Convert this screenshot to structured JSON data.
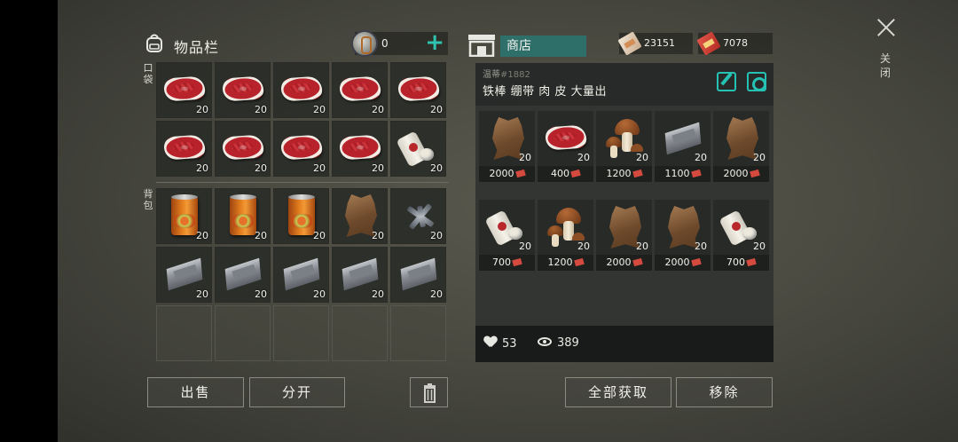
{
  "inventory": {
    "title": "物品栏",
    "coin_value": "0",
    "plus_label": "+",
    "pocket_label": "口袋",
    "backpack_label": "背包",
    "pocket_slots": [
      {
        "item": "meat",
        "qty": "20"
      },
      {
        "item": "meat",
        "qty": "20"
      },
      {
        "item": "meat",
        "qty": "20"
      },
      {
        "item": "meat",
        "qty": "20"
      },
      {
        "item": "meat",
        "qty": "20"
      },
      {
        "item": "meat",
        "qty": "20"
      },
      {
        "item": "meat",
        "qty": "20"
      },
      {
        "item": "meat",
        "qty": "20"
      },
      {
        "item": "meat",
        "qty": "20"
      },
      {
        "item": "bandage",
        "qty": "20"
      }
    ],
    "backpack_slots": [
      {
        "item": "food-can",
        "qty": "20"
      },
      {
        "item": "food-can",
        "qty": "20"
      },
      {
        "item": "food-can",
        "qty": "20"
      },
      {
        "item": "pelt",
        "qty": "20"
      },
      {
        "item": "scrap-metal",
        "qty": "20"
      },
      {
        "item": "iron-ingot",
        "qty": "20"
      },
      {
        "item": "iron-ingot",
        "qty": "20"
      },
      {
        "item": "iron-ingot",
        "qty": "20"
      },
      {
        "item": "iron-ingot",
        "qty": "20"
      },
      {
        "item": "iron-ingot",
        "qty": "20"
      },
      {
        "item": "",
        "qty": ""
      },
      {
        "item": "",
        "qty": ""
      },
      {
        "item": "",
        "qty": ""
      },
      {
        "item": "",
        "qty": ""
      },
      {
        "item": "",
        "qty": ""
      }
    ],
    "sell_label": "出售",
    "split_label": "分开"
  },
  "shop": {
    "tab_label": "商店",
    "currency_1": "23151",
    "currency_2": "7078",
    "owner_name": "温蒂",
    "owner_id": "#1882",
    "description": "铁棒 绷带 肉 皮 大量出",
    "items": [
      {
        "item": "pelt",
        "qty": "20",
        "price": "2000"
      },
      {
        "item": "meat",
        "qty": "20",
        "price": "400"
      },
      {
        "item": "mushroom",
        "qty": "20",
        "price": "1200"
      },
      {
        "item": "iron-ingot",
        "qty": "20",
        "price": "1100"
      },
      {
        "item": "pelt",
        "qty": "20",
        "price": "2000"
      },
      {
        "item": "bandage",
        "qty": "20",
        "price": "700"
      },
      {
        "item": "mushroom",
        "qty": "20",
        "price": "1200"
      },
      {
        "item": "pelt",
        "qty": "20",
        "price": "2000"
      },
      {
        "item": "pelt",
        "qty": "20",
        "price": "2000"
      },
      {
        "item": "bandage",
        "qty": "20",
        "price": "700"
      }
    ],
    "likes": "53",
    "views": "389",
    "take_all_label": "全部获取",
    "remove_label": "移除"
  },
  "close_label": "关闭",
  "colors": {
    "accent": "#2fc3b0",
    "shop_tab": "#2f6f6a"
  }
}
